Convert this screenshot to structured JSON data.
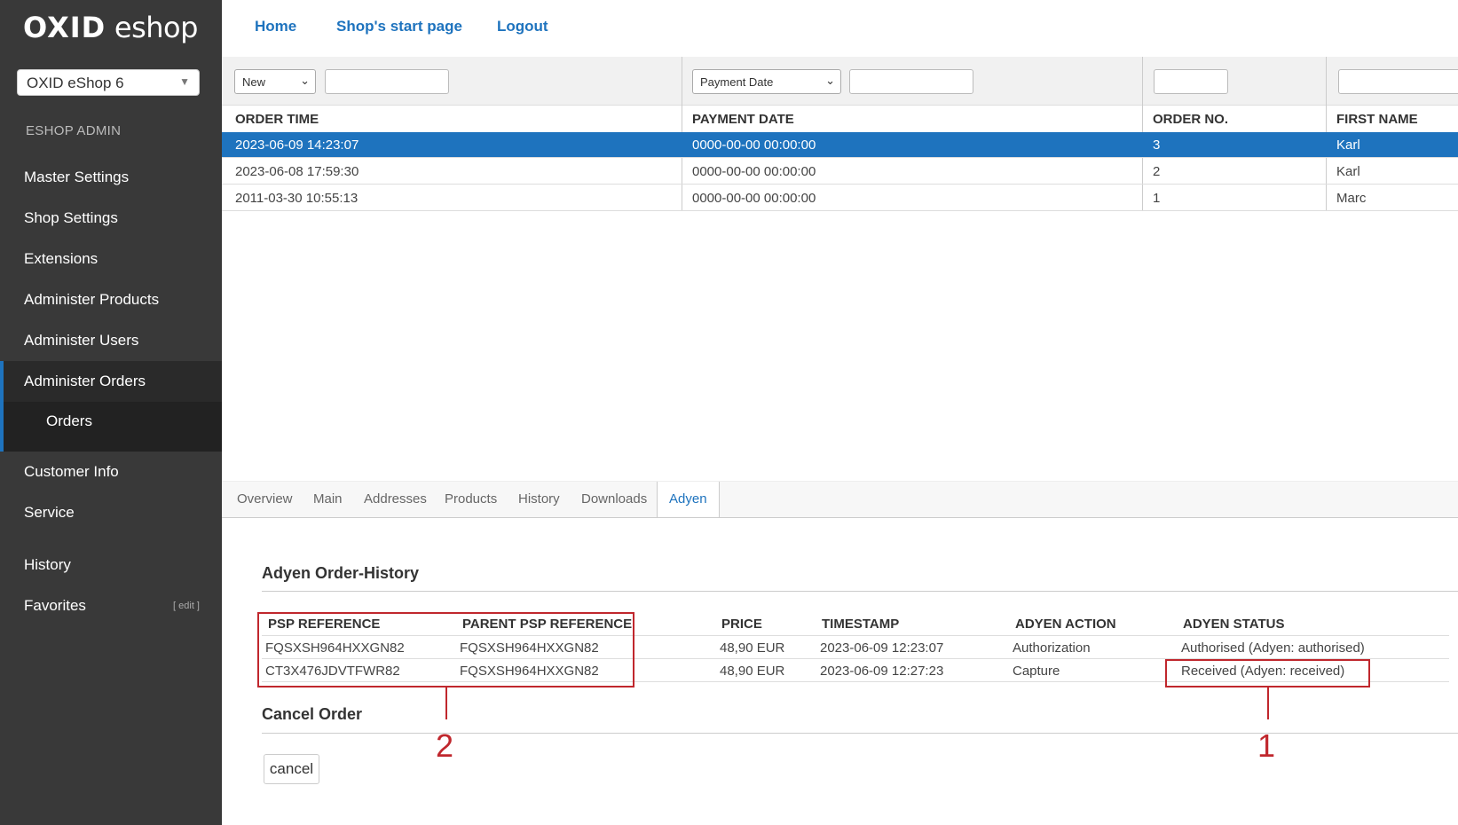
{
  "logo": {
    "bold": "OXID",
    "light": "eshop"
  },
  "shop_selector": {
    "value": "OXID eShop 6"
  },
  "sidebar": {
    "section_title": "ESHOP ADMIN",
    "items": [
      "Master Settings",
      "Shop Settings",
      "Extensions",
      "Administer Products",
      "Administer Users",
      "Administer Orders"
    ],
    "sub_item": "Orders",
    "lower_items": [
      "Customer Info",
      "Service"
    ],
    "history": "History",
    "favorites": "Favorites",
    "favorites_edit": "[ edit ]"
  },
  "topnav": [
    "Home",
    "Shop's start page",
    "Logout"
  ],
  "filters": {
    "status": "New",
    "date_field": "Payment Date"
  },
  "orders": {
    "columns": [
      "ORDER TIME",
      "PAYMENT DATE",
      "ORDER NO.",
      "FIRST NAME"
    ],
    "rows": [
      [
        "2023-06-09 14:23:07",
        "0000-00-00 00:00:00",
        "3",
        "Karl"
      ],
      [
        "2023-06-08 17:59:30",
        "0000-00-00 00:00:00",
        "2",
        "Karl"
      ],
      [
        "2011-03-30 10:55:13",
        "0000-00-00 00:00:00",
        "1",
        "Marc"
      ]
    ],
    "selected_row": 0
  },
  "tabs": [
    "Overview",
    "Main",
    "Addresses",
    "Products",
    "History",
    "Downloads",
    "Adyen"
  ],
  "active_tab": "Adyen",
  "adyen": {
    "history_title": "Adyen Order-History",
    "columns": [
      "PSP REFERENCE",
      "PARENT PSP REFERENCE",
      "PRICE",
      "TIMESTAMP",
      "ADYEN ACTION",
      "ADYEN STATUS"
    ],
    "rows": [
      [
        "FQSXSH964HXXGN82",
        "FQSXSH964HXXGN82",
        "48,90 EUR",
        "2023-06-09 12:23:07",
        "Authorization",
        "Authorised (Adyen: authorised)"
      ],
      [
        "CT3X476JDVTFWR82",
        "FQSXSH964HXXGN82",
        "48,90 EUR",
        "2023-06-09 12:27:23",
        "Capture",
        "Received (Adyen: received)"
      ]
    ],
    "cancel_title": "Cancel Order",
    "cancel_button": "cancel"
  },
  "callouts": [
    "2",
    "1"
  ],
  "colors": {
    "sidebar": "#393939",
    "accent": "#1e73be",
    "callout": "#c0272d"
  }
}
